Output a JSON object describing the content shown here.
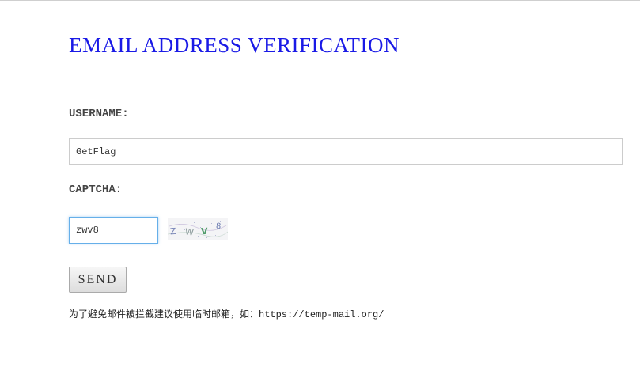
{
  "page": {
    "title": "EMAIL ADDRESS VERIFICATION"
  },
  "form": {
    "username_label": "USERNAME:",
    "username_value": "GetFlag",
    "captcha_label": "CAPTCHA:",
    "captcha_value": "zwv8",
    "captcha_image_text": "ZWV8",
    "send_label": "SEND"
  },
  "hint": {
    "text": "为了避免邮件被拦截建议使用临时邮箱，如：",
    "url": "https://temp-mail.org/"
  },
  "colors": {
    "title": "#1a1ae6",
    "input_focus_border": "#66afe9"
  }
}
